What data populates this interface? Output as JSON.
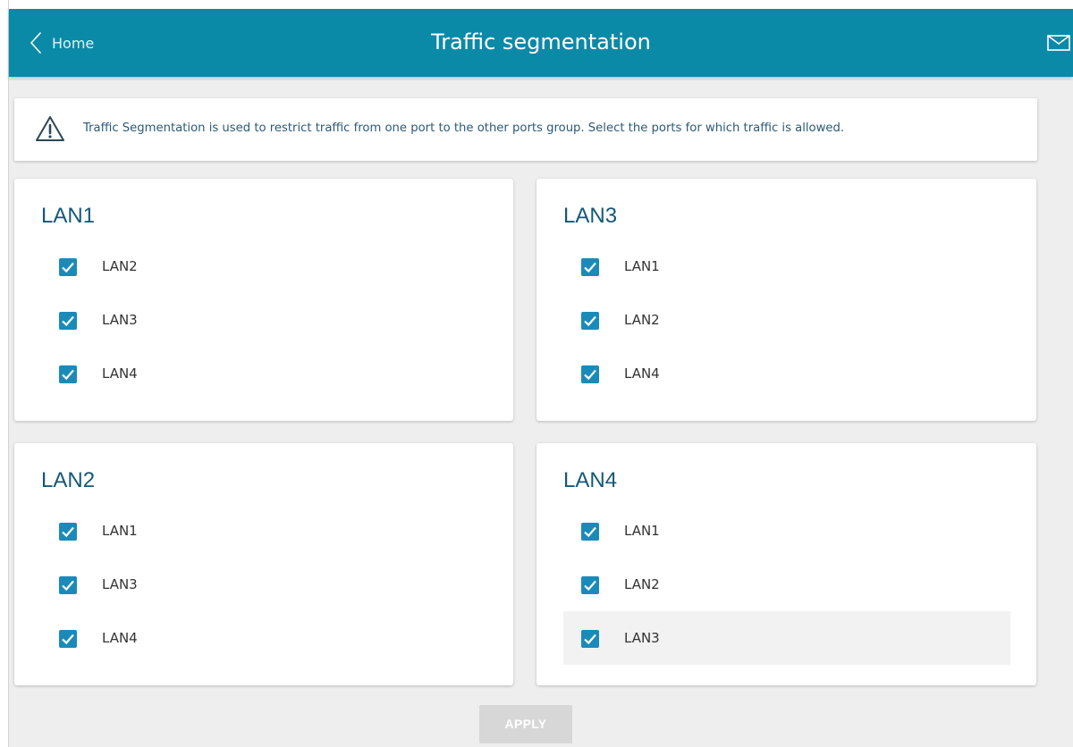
{
  "header": {
    "back_label": "Home",
    "title": "Traffic segmentation",
    "color": "#0b8aa7"
  },
  "notice": {
    "text": "Traffic Segmentation is used to restrict traffic from one port to the other ports group. Select the ports for which traffic is allowed."
  },
  "groups": [
    {
      "title": "LAN1",
      "ports": [
        {
          "label": "LAN2",
          "checked": true
        },
        {
          "label": "LAN3",
          "checked": true
        },
        {
          "label": "LAN4",
          "checked": true
        }
      ]
    },
    {
      "title": "LAN3",
      "ports": [
        {
          "label": "LAN1",
          "checked": true
        },
        {
          "label": "LAN2",
          "checked": true
        },
        {
          "label": "LAN4",
          "checked": true
        }
      ]
    },
    {
      "title": "LAN2",
      "ports": [
        {
          "label": "LAN1",
          "checked": true
        },
        {
          "label": "LAN3",
          "checked": true
        },
        {
          "label": "LAN4",
          "checked": true
        }
      ]
    },
    {
      "title": "LAN4",
      "ports": [
        {
          "label": "LAN1",
          "checked": true
        },
        {
          "label": "LAN2",
          "checked": true
        },
        {
          "label": "LAN3",
          "checked": true
        }
      ]
    }
  ],
  "apply_label": "APPLY",
  "icons": {
    "back": "chevron-left-icon",
    "mail": "envelope-icon",
    "notice": "warning-icon",
    "checkbox": "checkmark-icon"
  },
  "colors": {
    "accent": "#1a8bb9",
    "title_text": "#14587a",
    "notice_text": "#2c5a78",
    "apply_disabled": "#d7d7d7"
  }
}
